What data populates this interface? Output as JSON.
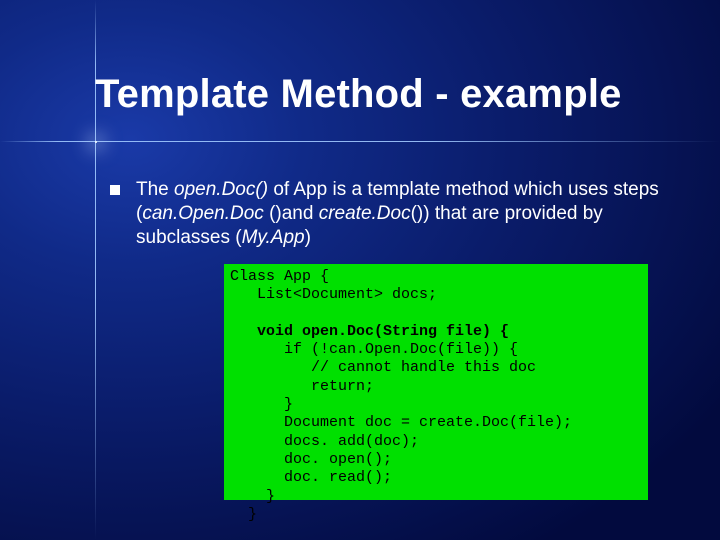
{
  "slide": {
    "title": "Template Method - example",
    "bullet": {
      "seg1": "The ",
      "em1": "open.Doc() ",
      "seg2": "of App is a template method which uses steps (",
      "em2": "can.Open.Doc ",
      "seg3": "()and ",
      "em3": "create.Doc",
      "seg4": "()) that are provided by subclasses (",
      "em4": "My.App",
      "seg5": ")"
    },
    "code": {
      "l1": "Class App {",
      "l2": "   List<Document> docs;",
      "l3": "",
      "l4": "   void open.Doc(String file) {",
      "l5": "      if (!can.Open.Doc(file)) {",
      "l6": "         // cannot handle this doc",
      "l7": "         return;",
      "l8": "      }",
      "l9": "      Document doc = create.Doc(file);",
      "l10": "      docs. add(doc);",
      "l11": "      doc. open();",
      "l12": "      doc. read();",
      "l13": "    }",
      "l14": "  }"
    }
  }
}
